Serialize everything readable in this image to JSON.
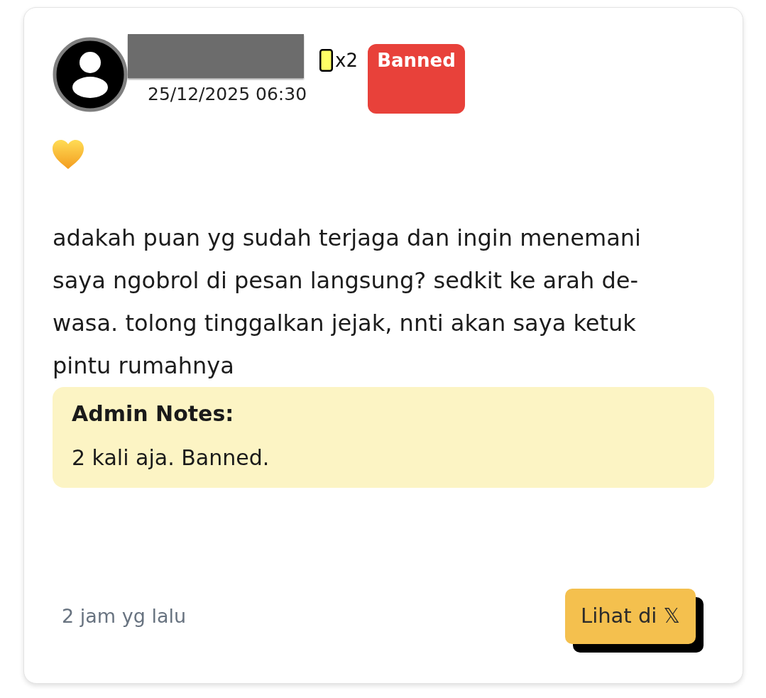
{
  "post": {
    "timestamp": "25/12/2025 06:30",
    "warning": {
      "kind": "yellow",
      "count": "x2"
    },
    "status_badge": "Banned",
    "body": "adakah puan yg sudah terjaga dan ingin menemani saya ngobrol di pesan langsung? sedkit ke arah de-wasa. tolong tinggalkan jejak, nnti akan saya ketuk pintu rumahnya"
  },
  "admin_notes": {
    "title": "Admin Notes:",
    "text": "2 kali aja. Banned."
  },
  "footer": {
    "relative_time": "2 jam yg lalu",
    "view_button": "Lihat di 𝕏"
  }
}
